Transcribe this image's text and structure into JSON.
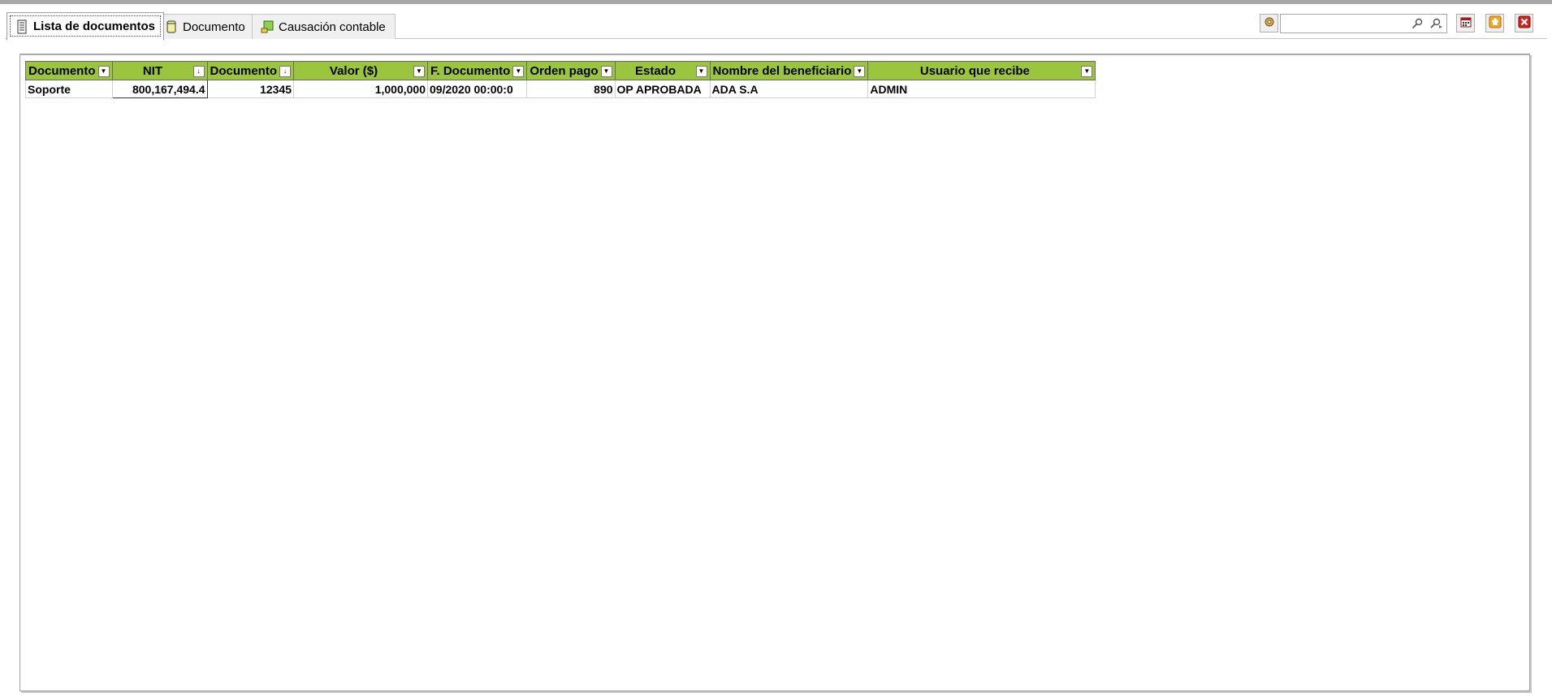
{
  "tabs": [
    {
      "label": "Lista de documentos",
      "icon": "list-document-icon",
      "active": true
    },
    {
      "label": "Documento",
      "icon": "document-cylinder-icon",
      "active": false
    },
    {
      "label": "Causación contable",
      "icon": "accounting-icon",
      "active": false
    }
  ],
  "toolbar": {
    "search_value": "",
    "icons": [
      "config-icon",
      "search-icon",
      "search-next-icon",
      "calendar-icon",
      "home-icon",
      "close-window-icon"
    ]
  },
  "grid": {
    "header_color": "#9bc43f",
    "columns": [
      {
        "label": "Documento",
        "filter": "dropdown"
      },
      {
        "label": "NIT",
        "filter": "sort"
      },
      {
        "label": "Documento",
        "filter": "sort"
      },
      {
        "label": "Valor ($)",
        "filter": "dropdown"
      },
      {
        "label": "F. Documento",
        "filter": "dropdown"
      },
      {
        "label": "Orden pago",
        "filter": "dropdown"
      },
      {
        "label": "Estado",
        "filter": "dropdown"
      },
      {
        "label": "Nombre del beneficiario",
        "filter": "dropdown"
      },
      {
        "label": "Usuario que recibe",
        "filter": "dropdown"
      }
    ],
    "rows": [
      [
        "Soporte",
        "800,167,494.4",
        "12345",
        "1,000,000",
        "09/2020 00:00:0",
        "890",
        "OP APROBADA",
        "ADA S.A",
        "ADMIN"
      ]
    ]
  }
}
